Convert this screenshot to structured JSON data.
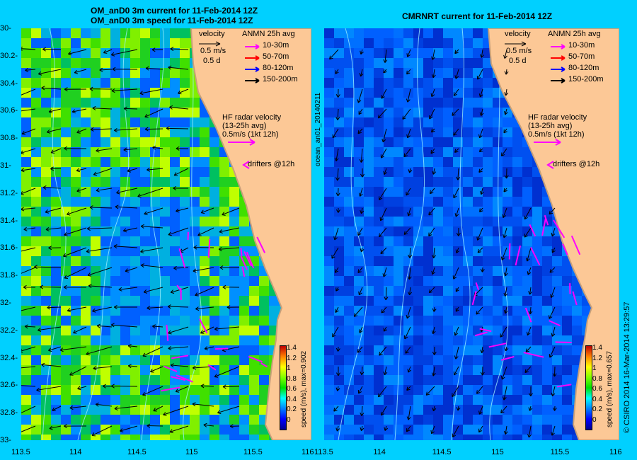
{
  "left_panel": {
    "title_line1": "OM_anD0 3m current for 11-Feb-2014 12Z",
    "title_line2": "OM_anD0 3m speed for 11-Feb-2014 12Z",
    "colorbar_label": "speed (m/s), max=0.902"
  },
  "right_panel": {
    "title": "CMRNRT current for 11-Feb-2014 12Z",
    "colorbar_label": "speed (m/s), max=0.657",
    "side_label": "ocean_an01_20140211"
  },
  "legend": {
    "velocity_label": "velocity",
    "scale_label": "0.5 m/s",
    "duration_label": "0.5 d",
    "anmn_title": "ANMN 25h avg",
    "depth_bins": [
      {
        "label": "10-30m",
        "color": "#ff00ff"
      },
      {
        "label": "50-70m",
        "color": "#ff0000"
      },
      {
        "label": "80-120m",
        "color": "#0000ff"
      },
      {
        "label": "150-200m",
        "color": "#000000"
      }
    ],
    "hf_radar_line1": "HF radar velocity",
    "hf_radar_line2": "(13-25h avg)",
    "hf_radar_line3": "0.5m/s (1kt 12h)",
    "drifters_label": "drifters @12h"
  },
  "axes": {
    "x_ticks_left": [
      "113.5",
      "114",
      "114.5",
      "115",
      "115.5",
      "116"
    ],
    "x_ticks_right": [
      "113.5",
      "114",
      "114.5",
      "115",
      "115.5",
      "116"
    ],
    "y_ticks": [
      "-30",
      "-30.2",
      "-30.4",
      "-30.6",
      "-30.8",
      "-31",
      "-31.2",
      "-31.4",
      "-31.6",
      "-31.8",
      "-32",
      "-32.2",
      "-32.4",
      "-32.6",
      "-32.8",
      "-33"
    ]
  },
  "colorbar": {
    "ticks": [
      "1.4",
      "1.2",
      "1",
      "0.8",
      "0.6",
      "0.4",
      "0.2",
      "0"
    ],
    "colors": [
      "#00008f",
      "#0000ff",
      "#0080ff",
      "#00ffff",
      "#00e000",
      "#80ff00",
      "#ffff00",
      "#ff8000",
      "#c00000"
    ]
  },
  "colors": {
    "land": "#fcc896",
    "coast": "#c8a07a",
    "frame_bg": "#00d0ff",
    "anmn_surface": "#ff00ff"
  },
  "credit": "© CSIRO 2014  16-Mar-2014 13:29:57"
}
